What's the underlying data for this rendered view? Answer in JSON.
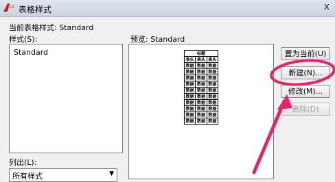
{
  "window": {
    "title": "表格样式",
    "close_glyph": "x"
  },
  "current_style": "当前表格样式: Standard",
  "styles_label": "样式(S):",
  "styles_list": [
    "Standard"
  ],
  "list_label": "列出(L):",
  "list_filter_value": "所有样式",
  "preview_label": "预览: Standard",
  "preview_table": {
    "title": "标题",
    "header_cells": [
      "表头",
      "表头",
      "表头"
    ],
    "cell_text": "数据"
  },
  "buttons": {
    "set_current": "置为当前(U)",
    "new": "新建(N)...",
    "modify": "修改(M)...",
    "delete": "删除(D)"
  },
  "colors": {
    "annotation": "#e8236a",
    "app_icon": "#c0201e"
  },
  "icons": {
    "app": "autocad-logo-icon",
    "combo_arrow": "dropdown-arrow-icon"
  }
}
